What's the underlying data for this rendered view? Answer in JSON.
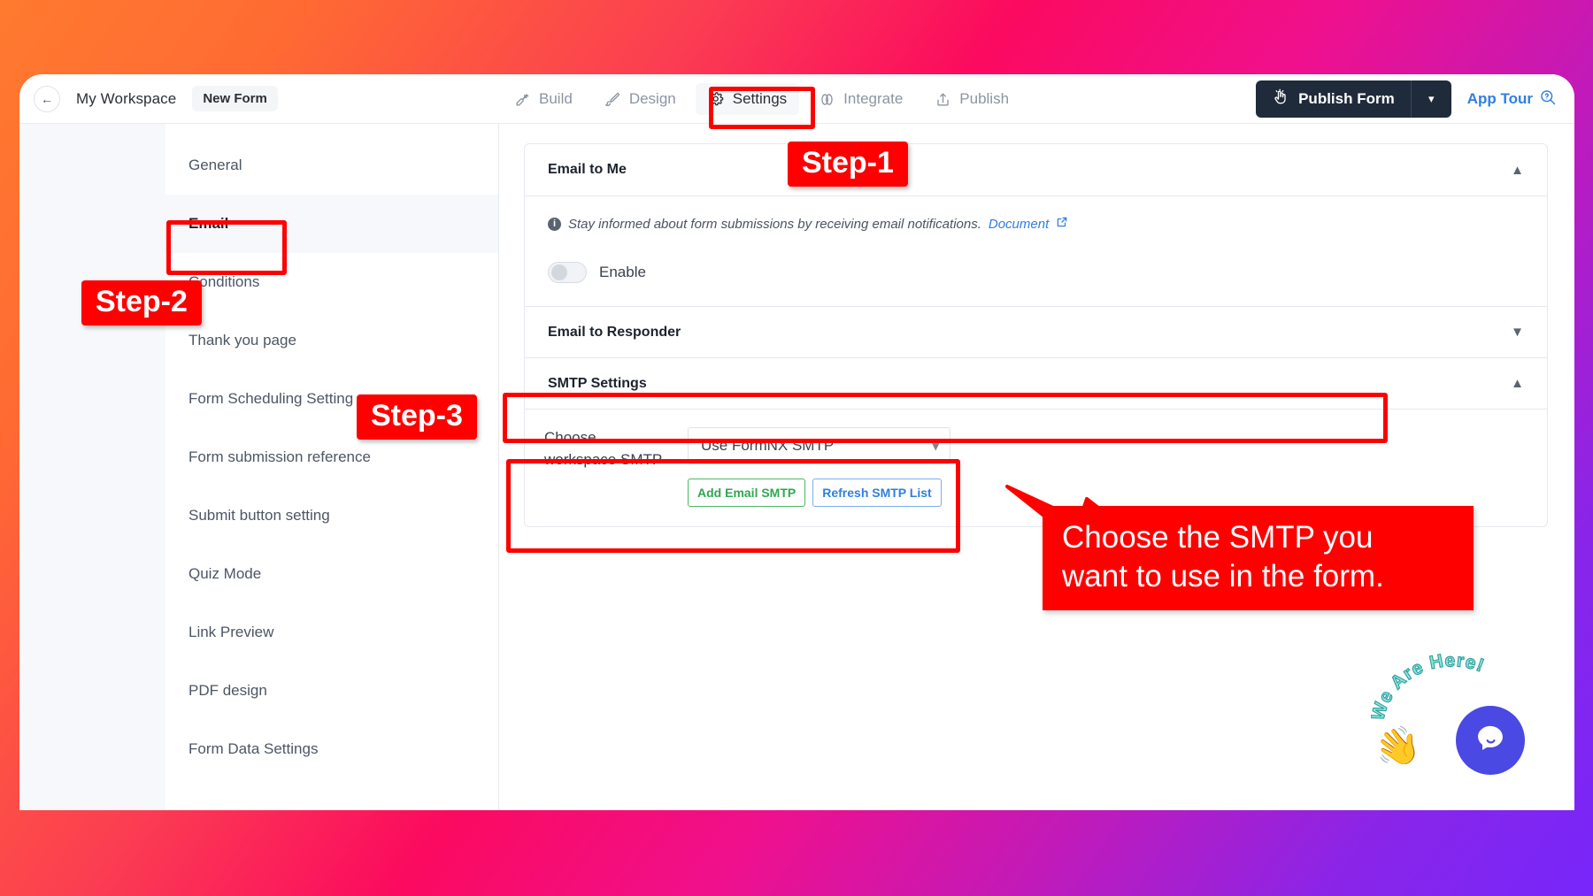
{
  "window": {
    "back_icon": "arrow-left-icon",
    "workspace": "My Workspace",
    "form_name": "New Form"
  },
  "tabs": [
    {
      "label": "Build",
      "icon": "wrench-icon",
      "active": false
    },
    {
      "label": "Design",
      "icon": "brush-icon",
      "active": false
    },
    {
      "label": "Settings",
      "icon": "gear-icon",
      "active": true
    },
    {
      "label": "Integrate",
      "icon": "link-icon",
      "active": false
    },
    {
      "label": "Publish",
      "icon": "upload-icon",
      "active": false
    }
  ],
  "topbar_right": {
    "publish_form_label": "Publish Form",
    "publish_icon": "hand-click-icon",
    "publish_caret": "chevron-down-icon",
    "app_tour_label": "App Tour",
    "app_tour_icon": "help-search-icon"
  },
  "sidebar": {
    "items": [
      {
        "label": "General",
        "active": false
      },
      {
        "label": "Email",
        "active": true
      },
      {
        "label": "Conditions",
        "active": false
      },
      {
        "label": "Thank you page",
        "active": false
      },
      {
        "label": "Form Scheduling Setting",
        "active": false
      },
      {
        "label": "Form submission reference",
        "active": false
      },
      {
        "label": "Submit button setting",
        "active": false
      },
      {
        "label": "Quiz Mode",
        "active": false
      },
      {
        "label": "Link Preview",
        "active": false
      },
      {
        "label": "PDF design",
        "active": false
      },
      {
        "label": "Form Data Settings",
        "active": false
      }
    ]
  },
  "content": {
    "email_to_me": {
      "title": "Email to Me",
      "chevron": "chevron-up-icon",
      "hint_text": "Stay informed about form submissions by receiving email notifications.",
      "doc_link": "Document",
      "doc_link_icon": "external-link-icon",
      "toggle_label": "Enable",
      "toggle_on": false
    },
    "email_to_responder": {
      "title": "Email to Responder",
      "chevron": "chevron-down-icon"
    },
    "smtp_settings": {
      "title": "SMTP Settings",
      "chevron": "chevron-up-icon",
      "field_label_line1": "Choose",
      "field_label_line2": "workspace SMTP",
      "select_value": "Use FormNX SMTP",
      "select_caret": "chevron-down-icon",
      "add_button": "Add Email SMTP",
      "refresh_button": "Refresh SMTP List"
    }
  },
  "annotations": {
    "step1": "Step-1",
    "step2": "Step-2",
    "step3": "Step-3",
    "callout_line1": "Choose the SMTP you",
    "callout_line2": "want to use in the form.",
    "color": "#ff0000"
  },
  "chat_widget": {
    "text": "We Are Here!",
    "hand_icon": "waving-hand-icon",
    "bubble_icon": "chat-bubble-icon",
    "bubble_color": "#4a49e4"
  }
}
